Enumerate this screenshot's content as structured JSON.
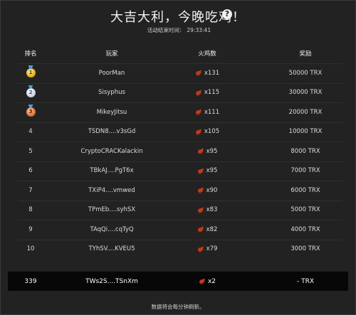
{
  "header": {
    "title": "大吉大利，今晚吃鸡！",
    "subtitle_label": "活动结束时间：",
    "subtitle_time": "29:33:41"
  },
  "columns": {
    "rank": "排名",
    "player": "玩家",
    "turkeys": "火鸡数",
    "reward": "奖励"
  },
  "rows": [
    {
      "rank": "1",
      "medal": "gold",
      "player": "PoorMan",
      "turkeys": "x131",
      "reward": "50000 TRX"
    },
    {
      "rank": "2",
      "medal": "silver",
      "player": "Sisyphus",
      "turkeys": "x115",
      "reward": "30000 TRX"
    },
    {
      "rank": "3",
      "medal": "bronze",
      "player": "MikeyJitsu",
      "turkeys": "x111",
      "reward": "20000 TRX"
    },
    {
      "rank": "4",
      "player": "TSDN8....v3sGd",
      "turkeys": "x105",
      "reward": "10000 TRX"
    },
    {
      "rank": "5",
      "player": "CryptoCRACKalackin",
      "turkeys": "x95",
      "reward": "8000 TRX"
    },
    {
      "rank": "6",
      "player": "TBkAJ....PgT6x",
      "turkeys": "x95",
      "reward": "7000 TRX"
    },
    {
      "rank": "7",
      "player": "TXiP4....vmwed",
      "turkeys": "x90",
      "reward": "6000 TRX"
    },
    {
      "rank": "8",
      "player": "TPmEb....syhSX",
      "turkeys": "x83",
      "reward": "5000 TRX"
    },
    {
      "rank": "9",
      "player": "TAqQi....cqTyQ",
      "turkeys": "x82",
      "reward": "4000 TRX"
    },
    {
      "rank": "10",
      "player": "TYhSV....KVEU5",
      "turkeys": "x79",
      "reward": "3000 TRX"
    }
  ],
  "me": {
    "rank": "339",
    "player": "TWs2S....TSnXm",
    "turkeys": "x2",
    "reward": "- TRX"
  },
  "footer": "数据将会每分钟刷新。",
  "icons": {
    "help": "help-icon",
    "turkey": "turkey-icon",
    "medal": "medal-icon"
  },
  "colors": {
    "turkey": "#c0391b",
    "background": "#222222",
    "my_row": "#070707"
  }
}
